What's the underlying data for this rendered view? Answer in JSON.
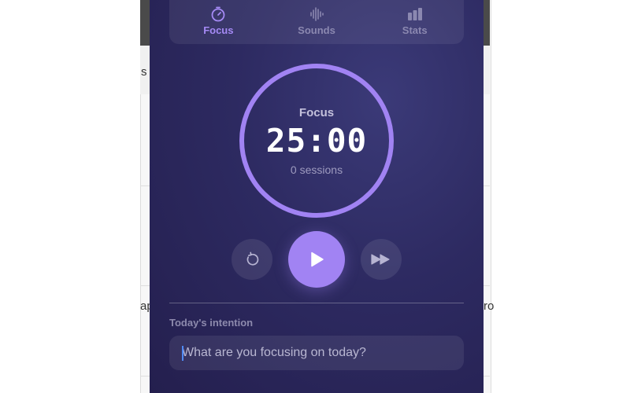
{
  "background": {
    "fragments": [
      "s",
      "ap",
      "ro"
    ]
  },
  "tabs": [
    {
      "label": "Focus",
      "icon": "timer-icon",
      "active": true
    },
    {
      "label": "Sounds",
      "icon": "waveform-icon",
      "active": false
    },
    {
      "label": "Stats",
      "icon": "bar-chart-icon",
      "active": false
    }
  ],
  "timer": {
    "mode": "Focus",
    "time": "25:00",
    "sessions": "0 sessions"
  },
  "controls": {
    "reset_icon": "reset-icon",
    "play_icon": "play-icon",
    "skip_icon": "skip-forward-icon"
  },
  "intention": {
    "label": "Today's intention",
    "placeholder": "What are you focusing on today?",
    "value": ""
  },
  "colors": {
    "accent": "#a183f3",
    "panel_bg": "#2d2a61",
    "caret": "#4f8af5"
  }
}
